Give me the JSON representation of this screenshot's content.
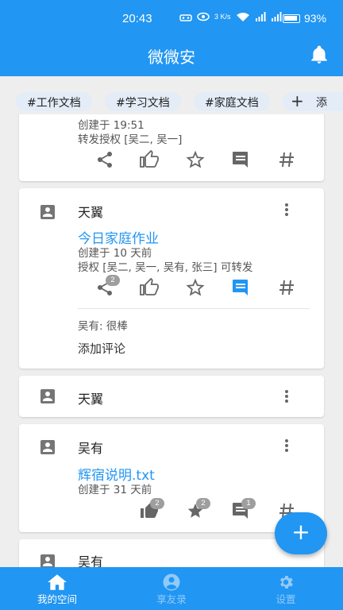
{
  "status_bar": {
    "time": "20:43",
    "net_speed": "3 K/s",
    "battery": "93%"
  },
  "app_bar": {
    "title": "微微安"
  },
  "tags": [
    "#工作文档",
    "#学习文档",
    "#家庭文档"
  ],
  "tag_add_label": "添",
  "cards": [
    {
      "meta1": "创建于 19:51",
      "meta2": "转发授权 [吴二, 吴一]"
    },
    {
      "author": "天翼",
      "title": "今日家庭作业",
      "meta1": "创建于 10 天前",
      "meta2": "授权 [吴二, 吴一, 吴有, 张三] 可转发",
      "share_count": "2",
      "comment": "吴有: 很棒",
      "add_comment": "添加评论"
    },
    {
      "author": "天翼"
    },
    {
      "author": "吴有",
      "title": "辉宿说明.txt",
      "meta1": "创建于 31 天前",
      "like_count": "2",
      "star_count": "2",
      "comment_count": "1"
    },
    {
      "author": "吴有"
    }
  ],
  "fab": {
    "label": "+"
  },
  "bottom_nav": [
    {
      "label": "我的空间",
      "icon": "home-icon"
    },
    {
      "label": "享友录",
      "icon": "account-circle-icon"
    },
    {
      "label": "设置",
      "icon": "gear-icon"
    }
  ],
  "colors": {
    "primary": "#2196f3",
    "active_comment": "#2196f3",
    "inactive_nav": "#90caf9"
  }
}
